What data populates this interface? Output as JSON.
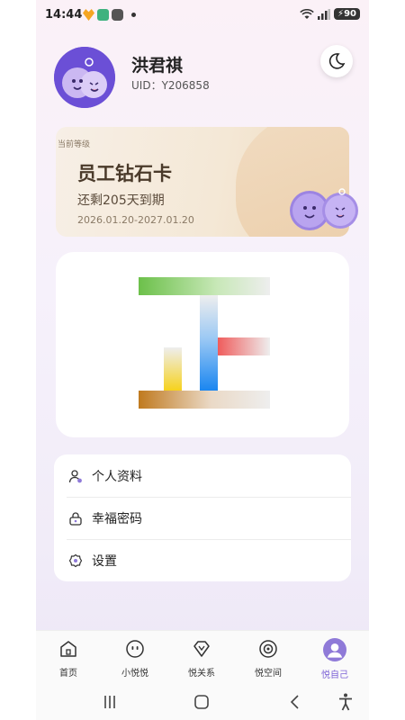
{
  "status": {
    "time": "14:44",
    "battery": "90"
  },
  "profile": {
    "name": "洪君祺",
    "uid": "UID：Y206858"
  },
  "card": {
    "level_label": "当前等级",
    "title": "员工钻石卡",
    "remaining": "还剩205天到期",
    "period": "2026.01.20-2027.01.20"
  },
  "menu": {
    "items": [
      {
        "label": "个人资料",
        "icon": "person-icon"
      },
      {
        "label": "幸福密码",
        "icon": "lock-icon"
      },
      {
        "label": "设置",
        "icon": "settings-icon"
      }
    ]
  },
  "nav": {
    "items": [
      {
        "label": "首页",
        "icon": "home-icon"
      },
      {
        "label": "小悦悦",
        "icon": "face-icon"
      },
      {
        "label": "悦关系",
        "icon": "diamond-icon"
      },
      {
        "label": "悦空间",
        "icon": "target-icon"
      },
      {
        "label": "悦自己",
        "icon": "avatar-icon"
      }
    ],
    "active_index": 4
  },
  "colors": {
    "accent": "#7d63d6",
    "card_text": "#4a3a2a"
  }
}
